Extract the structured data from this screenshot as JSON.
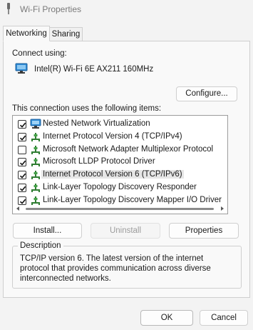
{
  "window": {
    "title": "Wi-Fi Properties",
    "accent_color": "#0067c0"
  },
  "tabs": [
    {
      "label": "Networking",
      "active": true
    },
    {
      "label": "Sharing",
      "active": false
    }
  ],
  "connect_using": {
    "label": "Connect using:",
    "adapter_name": "Intel(R) Wi-Fi 6E AX211 160MHz",
    "adapter_icon": "network-adapter-icon"
  },
  "buttons": {
    "configure": "Configure...",
    "install": "Install...",
    "uninstall": "Uninstall",
    "properties": "Properties",
    "ok": "OK",
    "cancel": "Cancel"
  },
  "items_label": "This connection uses the following items:",
  "items": [
    {
      "label": "Nested Network Virtualization",
      "checked": true,
      "icon": "network-service-icon"
    },
    {
      "label": "Internet Protocol Version 4 (TCP/IPv4)",
      "checked": true,
      "icon": "protocol-icon"
    },
    {
      "label": "Microsoft Network Adapter Multiplexor Protocol",
      "checked": false,
      "icon": "protocol-icon"
    },
    {
      "label": "Microsoft LLDP Protocol Driver",
      "checked": true,
      "icon": "protocol-icon"
    },
    {
      "label": "Internet Protocol Version 6 (TCP/IPv6)",
      "checked": true,
      "icon": "protocol-icon",
      "selected": true
    },
    {
      "label": "Link-Layer Topology Discovery Responder",
      "checked": true,
      "icon": "protocol-icon"
    },
    {
      "label": "Link-Layer Topology Discovery Mapper I/O Driver",
      "checked": true,
      "icon": "protocol-icon"
    }
  ],
  "description": {
    "title": "Description",
    "text": "TCP/IP version 6. The latest version of the internet protocol that provides communication across diverse interconnected networks."
  }
}
